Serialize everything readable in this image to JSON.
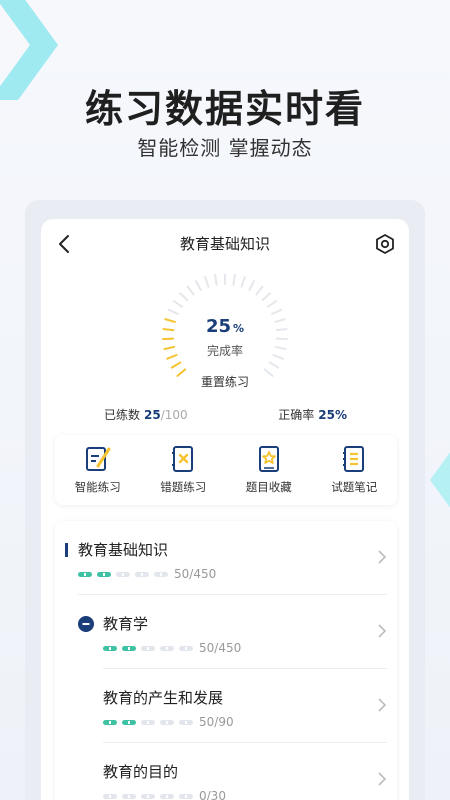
{
  "promo": {
    "headline": "练习数据实时看",
    "subline": "智能检测  掌握动态"
  },
  "nav": {
    "title": "教育基础知识"
  },
  "progress": {
    "value": 25,
    "percent_number": "25",
    "percent_unit": "%",
    "label": "完成率",
    "reset_label": "重置练习"
  },
  "stats": {
    "practiced_label": "已练数",
    "practiced_done": "25",
    "practiced_total": "/100",
    "accuracy_label": "正确率",
    "accuracy_value": "25%"
  },
  "tools": [
    {
      "label": "智能练习",
      "icon": "pen-notepad-icon"
    },
    {
      "label": "错题练习",
      "icon": "wrong-question-book-icon"
    },
    {
      "label": "题目收藏",
      "icon": "star-book-icon"
    },
    {
      "label": "试题笔记",
      "icon": "notebook-icon"
    }
  ],
  "chapters": [
    {
      "title": "教育基础知识",
      "progress": "50/450",
      "segments_on": 2,
      "segments_total": 5,
      "marker": "bar"
    },
    {
      "title": "教育学",
      "progress": "50/450",
      "segments_on": 2,
      "segments_total": 5,
      "marker": "minus-circle"
    },
    {
      "title": "教育的产生和发展",
      "progress": "50/90",
      "segments_on": 2,
      "segments_total": 5,
      "marker": "none"
    },
    {
      "title": "教育的目的",
      "progress": "0/30",
      "segments_on": 0,
      "segments_total": 5,
      "marker": "none"
    }
  ],
  "colors": {
    "accent": "#1a3e7a",
    "gauge_active": "#f5c230",
    "gauge_inactive": "#e4e7ec",
    "segment_on": "#3fc2a3",
    "segment_off": "#e3e7ed",
    "deco_cyan": "#7fe1ea"
  }
}
